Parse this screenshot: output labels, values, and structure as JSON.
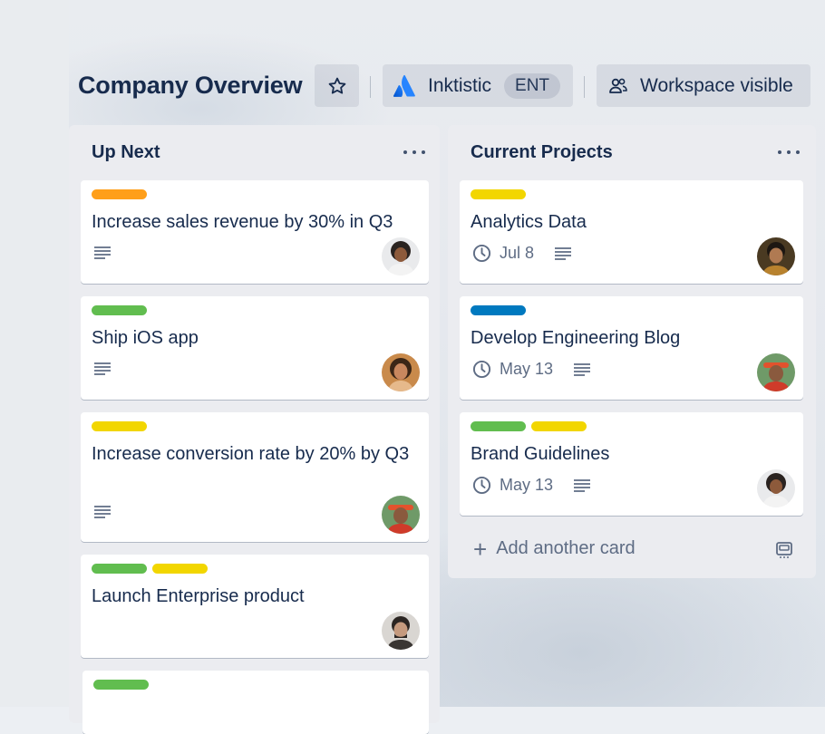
{
  "board": {
    "title": "Company Overview",
    "workspace_name": "Inktistic",
    "workspace_badge": "ENT",
    "visibility_label": "Workspace visible"
  },
  "lists": [
    {
      "title": "Up Next",
      "cards": [
        {
          "title": "Increase sales revenue by 30% in Q3",
          "labels": [
            "#ff9f1a"
          ],
          "has_description": true,
          "avatar": "member-1"
        },
        {
          "title": "Ship iOS app",
          "labels": [
            "#61bd4f"
          ],
          "has_description": true,
          "avatar": "member-2"
        },
        {
          "title": "Increase conversion rate by 20% by Q3",
          "labels": [
            "#f2d600"
          ],
          "has_description": true,
          "avatar": "member-3"
        },
        {
          "title": "Launch Enterprise product",
          "labels": [
            "#61bd4f",
            "#f2d600"
          ],
          "has_description": false,
          "avatar": "member-4"
        },
        {
          "title": "",
          "labels": [
            "#61bd4f"
          ]
        }
      ]
    },
    {
      "title": "Current Projects",
      "cards": [
        {
          "title": "Analytics Data",
          "labels": [
            "#f2d600"
          ],
          "due": "Jul 8",
          "has_description": true,
          "avatar": "member-5"
        },
        {
          "title": "Develop Engineering Blog",
          "labels": [
            "#0079bf"
          ],
          "due": "May 13",
          "has_description": true,
          "avatar": "member-3"
        },
        {
          "title": "Brand Guidelines",
          "labels": [
            "#61bd4f",
            "#f2d600"
          ],
          "due": "May 13",
          "has_description": true,
          "avatar": "member-1"
        }
      ],
      "add_card_label": "Add another card"
    }
  ],
  "icons": {
    "star": "star-icon",
    "workspace_logo": "atlassian-logo-icon",
    "visibility": "people-icon",
    "list_menu": "more-icon",
    "description": "description-icon",
    "due": "clock-icon",
    "add": "plus-icon",
    "template": "card-template-icon"
  }
}
